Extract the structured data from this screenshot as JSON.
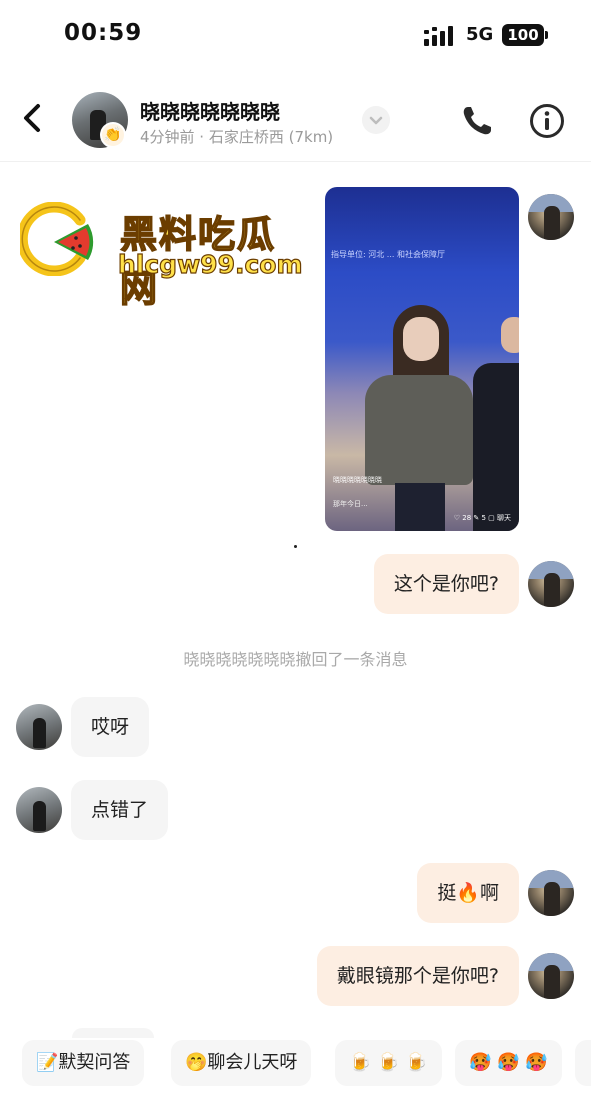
{
  "status_bar": {
    "time": "00:59",
    "network": "5G",
    "battery": "100"
  },
  "header": {
    "name": "晓晓晓晓晓晓晓",
    "subtitle": "4分钟前 · 石家庄桥西 (7km)",
    "badge_emoji": "👏"
  },
  "watermark": {
    "title": "黑料吃瓜网",
    "url": "hlcgw99.com"
  },
  "photo_message": {
    "screen_text": "指导单位: 河北 ... 和社会保障厅",
    "overlay_user": "晓晓晓晓晓晓晓",
    "overlay_caption": "那年今日...",
    "stats": "♡ 28  ✎ 5  ▢ 聊天"
  },
  "messages": [
    {
      "side": "me",
      "text": "这个是你吧?"
    },
    {
      "side": "system",
      "text": "晓晓晓晓晓晓晓撤回了一条消息"
    },
    {
      "side": "other",
      "text": "哎呀"
    },
    {
      "side": "other",
      "text": "点错了"
    },
    {
      "side": "me",
      "text": "挺🔥啊"
    },
    {
      "side": "me",
      "text": "戴眼镜那个是你吧?"
    }
  ],
  "quick_replies": [
    {
      "icon": "📝",
      "label": "默契问答"
    },
    {
      "icon": "🤭",
      "label": "聊会儿天呀"
    },
    {
      "icon": "",
      "label": "🍺 🍺 🍺"
    },
    {
      "icon": "",
      "label": "🥵 🥵 🥵"
    }
  ]
}
